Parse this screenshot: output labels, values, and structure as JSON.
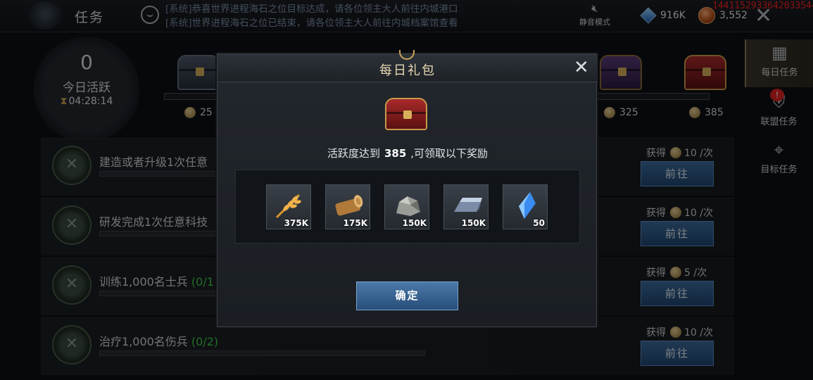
{
  "header": {
    "title": "任务",
    "news": [
      {
        "tag": "[系统]",
        "text": "恭喜世界进程海石之位目标达成，请各位领主大人前往内城港口"
      },
      {
        "tag": "[系统]",
        "text": "世界进程海石之位已结束，请各位领主大人前往内城档案馆查看"
      }
    ],
    "mute_label": "静音模式",
    "gems": "916K",
    "coins": "3,552",
    "debug_id": "1441152933642033544"
  },
  "activity": {
    "value": "0",
    "label": "今日活跃",
    "timer": "04:28:14"
  },
  "milestones": [
    {
      "points": "25"
    },
    {
      "points": "325"
    },
    {
      "points": "385"
    }
  ],
  "tasks": [
    {
      "text": "建造或者升级1次任意",
      "count": "",
      "reward_prefix": "获得",
      "reward": "10 /次",
      "button": "前往"
    },
    {
      "text": "研发完成1次任意科技",
      "count": "",
      "reward_prefix": "获得",
      "reward": "10 /次",
      "button": "前往"
    },
    {
      "text": "训练1,000名士兵 ",
      "count": "(0/1",
      "reward_prefix": "获得",
      "reward": "5 /次",
      "button": "前往"
    },
    {
      "text": "治疗1,000名伤兵 ",
      "count": "(0/2)",
      "reward_prefix": "获得",
      "reward": "10 /次",
      "button": "前往"
    }
  ],
  "side_tabs": [
    {
      "label": "每日任务",
      "icon": "calendar-icon"
    },
    {
      "label": "联盟任务",
      "icon": "alliance-icon",
      "badge": "!"
    },
    {
      "label": "目标任务",
      "icon": "map-pin-icon"
    }
  ],
  "modal": {
    "title": "每日礼包",
    "desc_prefix": "活跃度达到",
    "desc_value": "385",
    "desc_suffix": ",可领取以下奖励",
    "confirm": "确定",
    "rewards": [
      {
        "name": "wheat-icon",
        "qty": "375K"
      },
      {
        "name": "wood-icon",
        "qty": "175K"
      },
      {
        "name": "stone-icon",
        "qty": "150K"
      },
      {
        "name": "iron-icon",
        "qty": "150K"
      },
      {
        "name": "crystal-icon",
        "qty": "50"
      }
    ]
  }
}
